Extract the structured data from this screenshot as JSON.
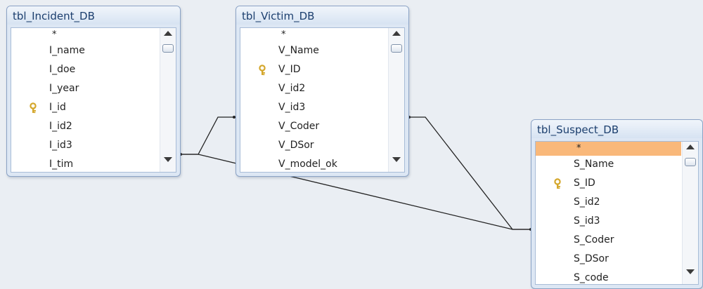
{
  "tables": [
    {
      "title": "tbl_Incident_DB",
      "fields": [
        {
          "name": "*"
        },
        {
          "name": "I_name"
        },
        {
          "name": "I_doe"
        },
        {
          "name": "I_year"
        },
        {
          "name": "I_id",
          "key": true
        },
        {
          "name": "I_id2"
        },
        {
          "name": "I_id3"
        },
        {
          "name": "I_tim"
        }
      ]
    },
    {
      "title": "tbl_Victim_DB",
      "fields": [
        {
          "name": "*"
        },
        {
          "name": "V_Name"
        },
        {
          "name": "V_ID",
          "key": true
        },
        {
          "name": "V_id2"
        },
        {
          "name": "V_id3"
        },
        {
          "name": "V_Coder"
        },
        {
          "name": "V_DSor"
        },
        {
          "name": "V_model_ok"
        }
      ]
    },
    {
      "title": "tbl_Suspect_DB",
      "fields": [
        {
          "name": "*",
          "selected": true
        },
        {
          "name": "S_Name"
        },
        {
          "name": "S_ID",
          "key": true
        },
        {
          "name": "S_id2"
        },
        {
          "name": "S_id3"
        },
        {
          "name": "S_Coder"
        },
        {
          "name": "S_DSor"
        },
        {
          "name": "S_code"
        }
      ]
    }
  ],
  "relationships": [
    {
      "from": "tbl_Incident_DB.I_id3",
      "to": "tbl_Victim_DB.V_id3"
    },
    {
      "from": "tbl_Victim_DB.V_id3",
      "to": "tbl_Suspect_DB.S_id3"
    },
    {
      "from": "tbl_Incident_DB.I_id3",
      "to": "tbl_Suspect_DB.S_id3"
    }
  ],
  "colors": {
    "canvas": "#eaeef3",
    "window_frame": "#dde7f4",
    "title_text": "#1c3f6e",
    "selection": "#f9b87a",
    "key_icon": "#d4a72c"
  },
  "icons": {
    "primary_key": "key-icon",
    "scroll_up": "scroll-up-arrow-icon",
    "scroll_down": "scroll-down-arrow-icon"
  }
}
